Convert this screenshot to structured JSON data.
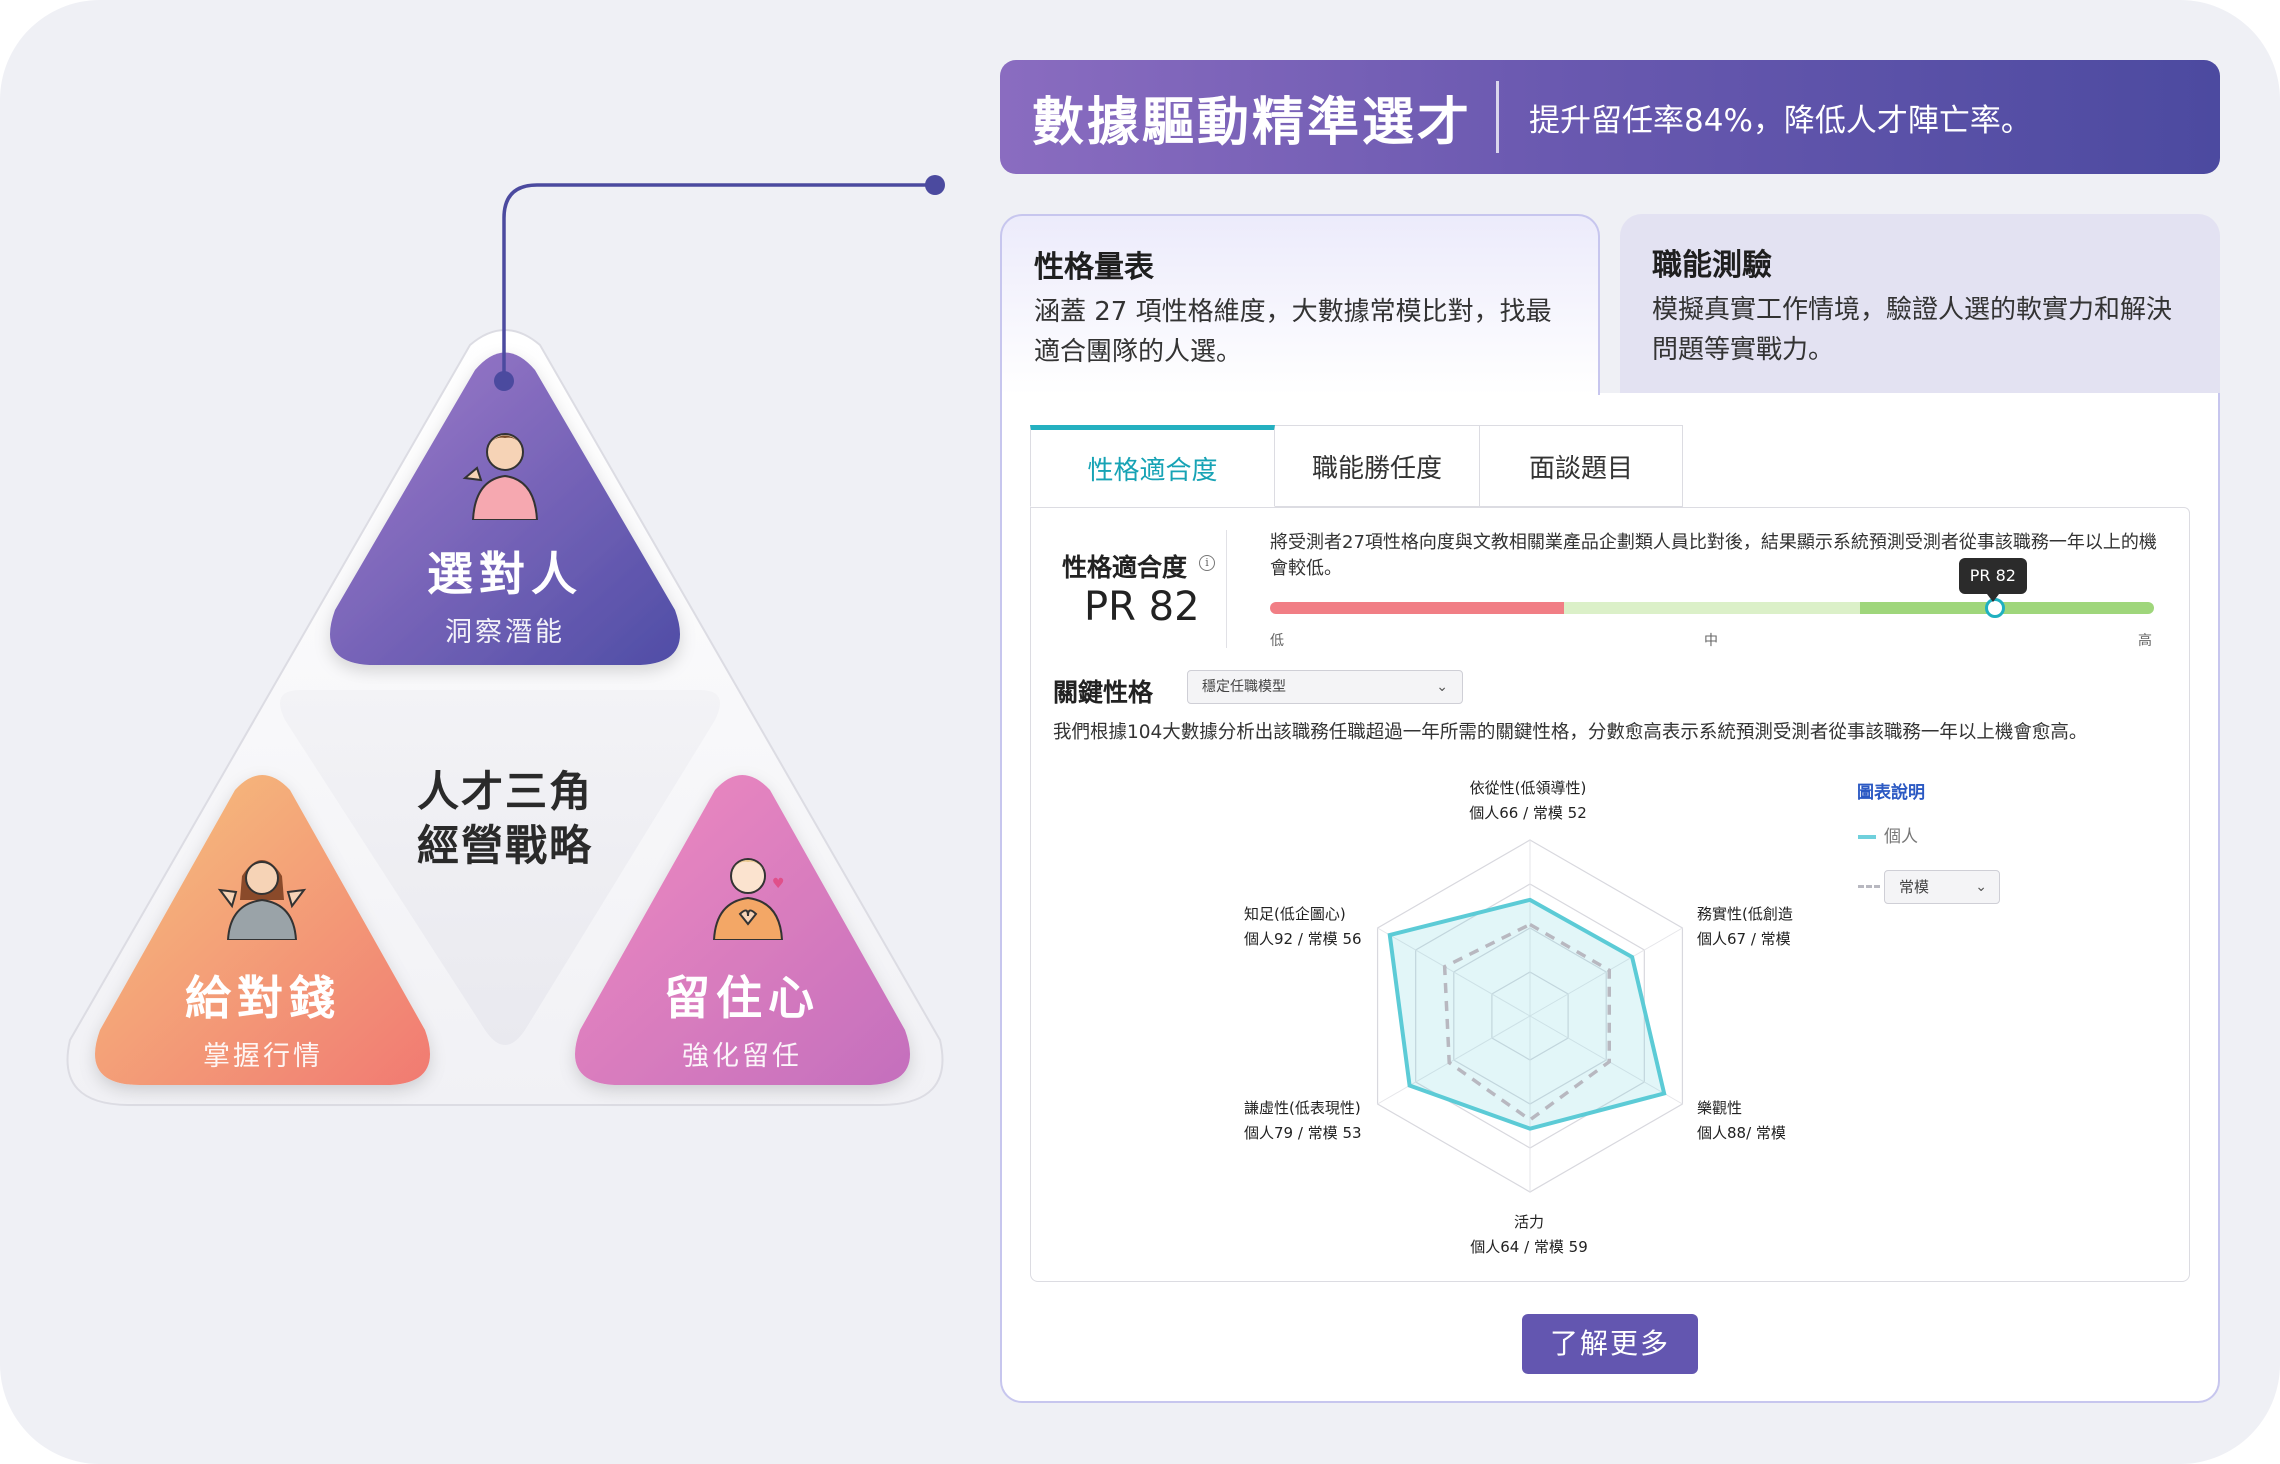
{
  "triangle": {
    "top": {
      "title": "選對人",
      "subtitle": "洞察潛能"
    },
    "left": {
      "title": "給對錢",
      "subtitle": "掌握行情"
    },
    "right": {
      "title": "留住心",
      "subtitle": "強化留任"
    },
    "center_line1": "人才三角",
    "center_line2": "經營戰略"
  },
  "banner": {
    "title": "數據驅動精準選才",
    "subtitle": "提升留任率84%，降低人才陣亡率。"
  },
  "cards": [
    {
      "title": "性格量表",
      "desc": "涵蓋 27 項性格維度，大數據常模比對，找最適合團隊的人選。"
    },
    {
      "title": "職能測驗",
      "desc": "模擬真實工作情境，驗證人選的軟實力和解決問題等實戰力。"
    }
  ],
  "tabs": [
    "性格適合度",
    "職能勝任度",
    "面談題目"
  ],
  "fit": {
    "label": "性格適合度",
    "info_icon": "i",
    "pr": "PR 82",
    "pr_value": 82,
    "tooltip": "PR 82",
    "description": "將受測者27項性格向度與文教相關業產品企劃類人員比對後，結果顯示系統預測受測者從事該職務一年以上的機會較低。",
    "scale": [
      "低",
      "中",
      "高"
    ]
  },
  "key_traits": {
    "label": "關鍵性格",
    "select_value": "穩定任職模型",
    "description": "我們根據104大數據分析出該職務任職超過一年所需的關鍵性格，分數愈高表示系統預測受測者從事該職務一年以上機會愈高。"
  },
  "chart_data": {
    "type": "radar",
    "axes": [
      {
        "name": "依從性(低領導性)",
        "label": "個人66 / 常模 52",
        "individual": 66,
        "norm": 52
      },
      {
        "name": "務實性(低創造",
        "label": "個人67 / 常模",
        "individual": 67,
        "norm": 52
      },
      {
        "name": "樂觀性",
        "label": "個人88/ 常模",
        "individual": 88,
        "norm": 52
      },
      {
        "name": "活力",
        "label": "個人64 / 常模 59",
        "individual": 64,
        "norm": 59
      },
      {
        "name": "謙虛性(低表現性)",
        "label": "個人79 / 常模 53",
        "individual": 79,
        "norm": 53
      },
      {
        "name": "知足(低企圖心)",
        "label": "個人92 / 常模 56",
        "individual": 92,
        "norm": 56
      }
    ],
    "range": [
      0,
      100
    ],
    "series": [
      {
        "name": "個人",
        "color": "#5ccbd6"
      },
      {
        "name": "常模",
        "color": "#b8b8c0"
      }
    ]
  },
  "legend": {
    "title": "圖表說明",
    "individual": "個人",
    "norm_select": "常模"
  },
  "button": {
    "label": "了解更多"
  },
  "colors": {
    "accent_purple": "#6356b0",
    "accent_teal": "#24b0c0",
    "bar_low": "#f17e85",
    "bar_mid": "#dbf0c8",
    "bar_high": "#9fd67b"
  }
}
